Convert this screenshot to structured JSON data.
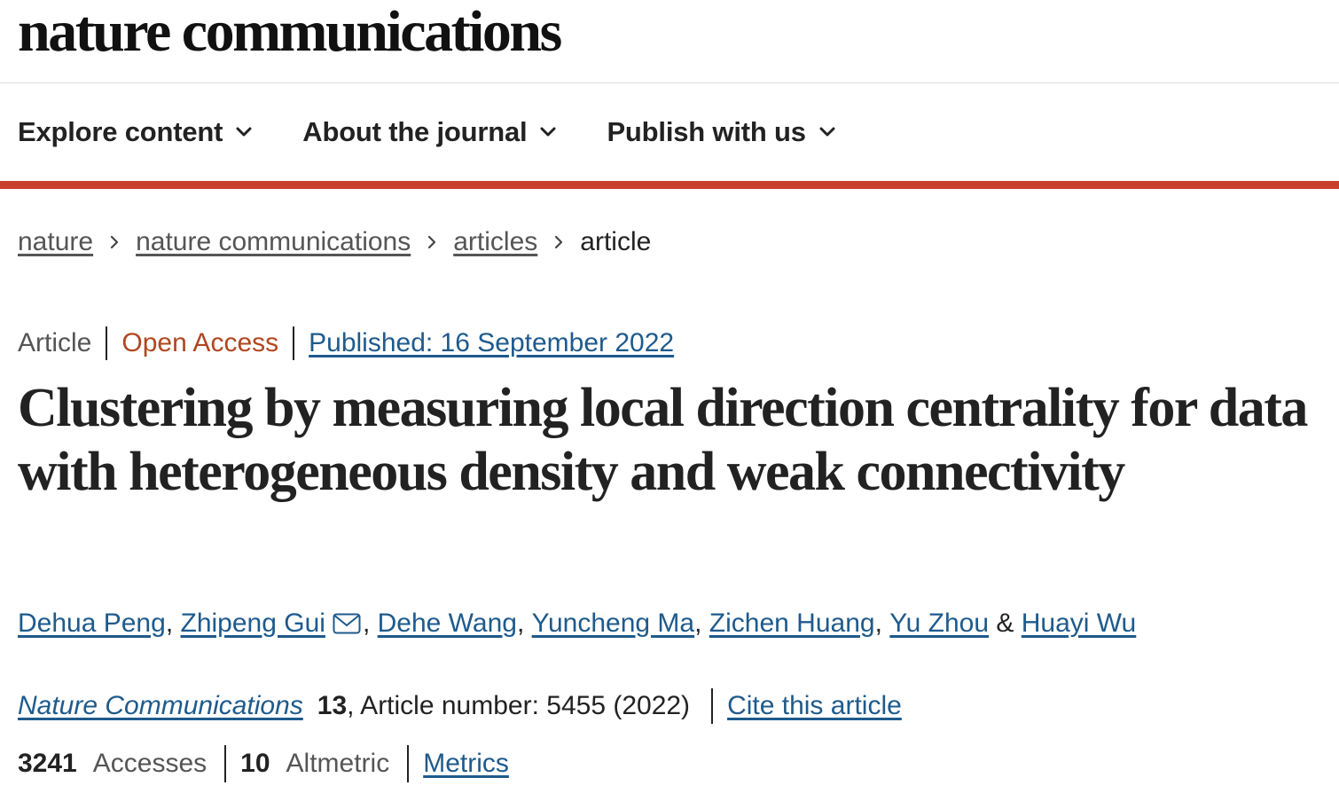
{
  "header": {
    "logo_text": "nature communications"
  },
  "nav": {
    "items": [
      {
        "label": "Explore content",
        "icon": "chevron-down-icon"
      },
      {
        "label": "About the journal",
        "icon": "chevron-down-icon"
      },
      {
        "label": "Publish with us",
        "icon": "chevron-down-icon"
      }
    ]
  },
  "accent_color": "#c9412c",
  "link_color": "#1e5a8c",
  "breadcrumb": {
    "items": [
      "nature",
      "nature communications",
      "articles"
    ],
    "current": "article",
    "separator_icon": "chevron-right-icon"
  },
  "article": {
    "type": "Article",
    "access": "Open Access",
    "published": "Published: 16 September 2022",
    "title": "Clustering by measuring local direction centrality for data with heterogeneous density and weak connectivity",
    "authors": [
      "Dehua Peng",
      "Zhipeng Gui",
      "Dehe Wang",
      "Yuncheng Ma",
      "Zichen Huang",
      "Yu Zhou",
      "Huayi Wu"
    ],
    "corresponding_author_icon": "mail-icon",
    "author_separator": ",",
    "last_author_separator": "&",
    "journal": "Nature Communications",
    "volume": "13",
    "article_number": ", Article number: 5455 (2022)",
    "cite_label": "Cite this article"
  },
  "metrics": {
    "accesses_value": "3241",
    "accesses_label": "Accesses",
    "altmetric_value": "10",
    "altmetric_label": "Altmetric",
    "metrics_link": "Metrics"
  }
}
